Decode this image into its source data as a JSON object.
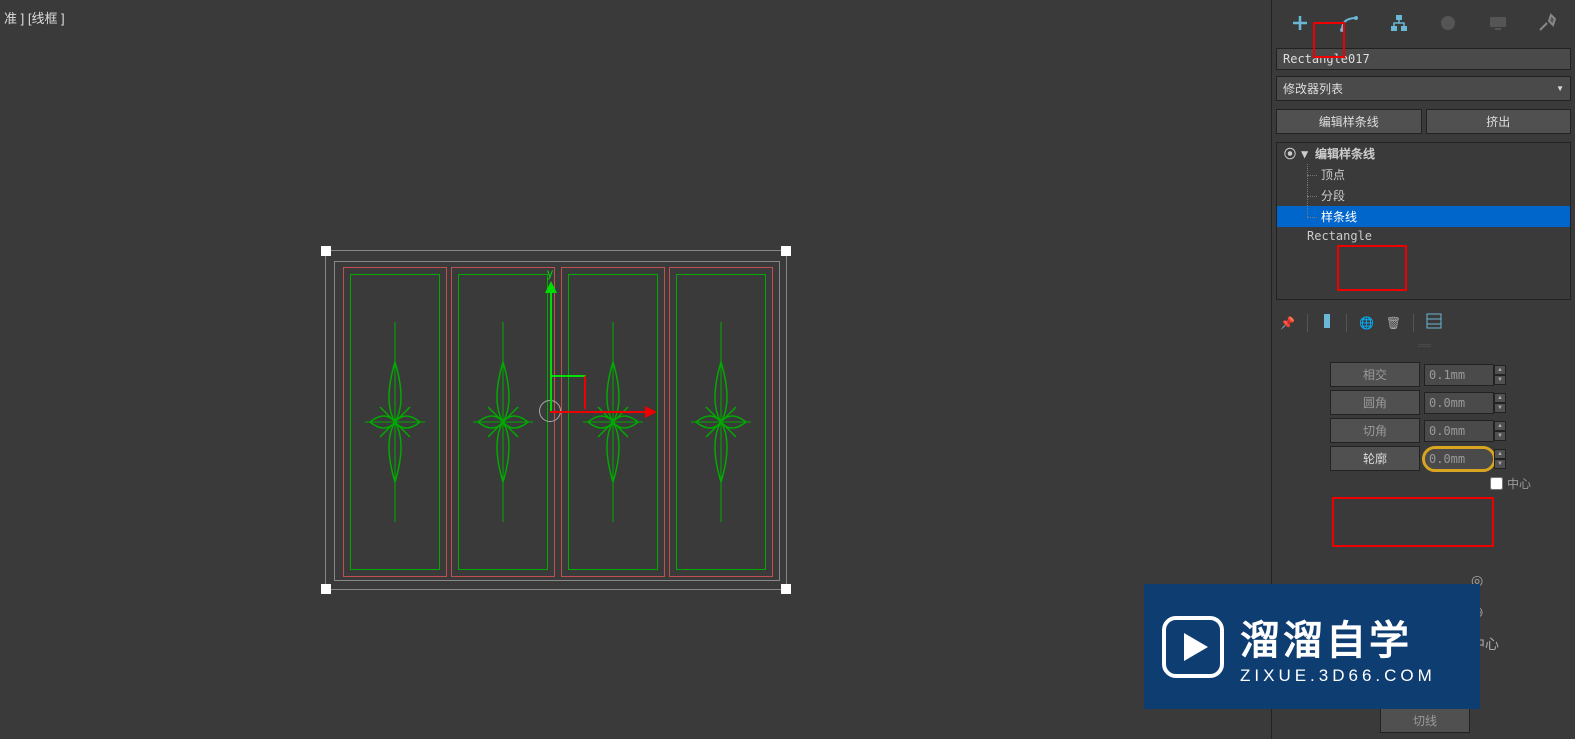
{
  "viewport": {
    "label": "准 ] [线框 ]"
  },
  "panel": {
    "objectName": "Rectangle017",
    "modifierListLabel": "修改器列表",
    "buttons": {
      "editSpline": "编辑样条线",
      "extrude": "挤出"
    },
    "stack": {
      "editSpline": "编辑样条线",
      "vertex": "顶点",
      "segment": "分段",
      "spline": "样条线",
      "rectangle": "Rectangle"
    },
    "params": {
      "intersect": {
        "label": "相交",
        "value": "0.1mm"
      },
      "fillet": {
        "label": "圆角",
        "value": "0.0mm"
      },
      "chamfer": {
        "label": "切角",
        "value": "0.0mm"
      },
      "outline": {
        "label": "轮廓",
        "value": "0.0mm"
      },
      "center": "中心",
      "trim": "切线"
    }
  },
  "gizmo": {
    "yLabel": "y"
  },
  "watermark": {
    "main": "溜溜自学",
    "sub": "ZIXUE.3D66.COM"
  }
}
